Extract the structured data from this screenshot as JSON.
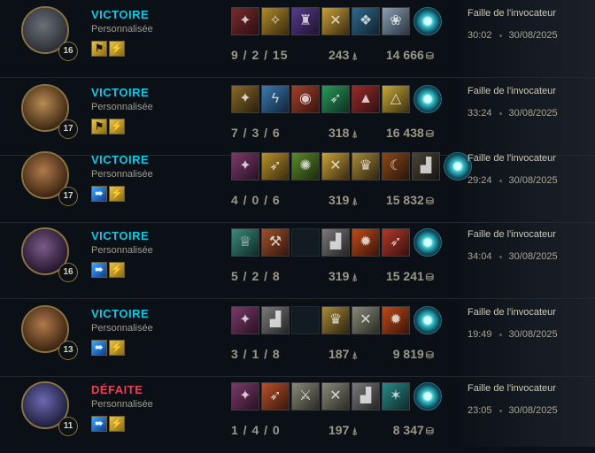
{
  "matches": [
    {
      "result": "VICTOIRE",
      "result_color": "#0acbe6",
      "mode": "Personnalisée",
      "level": "16",
      "champion_icon": "dark-masked-champion-icon",
      "portrait_colors": [
        "#6b6f78",
        "#2a2d33"
      ],
      "spells": [
        {
          "name": "gold-spell-icon",
          "style": "gold",
          "glyph": "⚑"
        },
        {
          "name": "flash-spell-icon",
          "style": "gold",
          "glyph": "⚡"
        }
      ],
      "items": [
        {
          "name": "red-blade-item-icon",
          "c1": "#7a2b2b",
          "c2": "#2a0e12",
          "glyph": "✦"
        },
        {
          "name": "golden-spear-item-icon",
          "c1": "#b08a2a",
          "c2": "#3a2a0c",
          "glyph": "✧"
        },
        {
          "name": "purple-tower-item-icon",
          "c1": "#5a3a8c",
          "c2": "#1c1230",
          "glyph": "♜"
        },
        {
          "name": "crossed-blades-item-icon",
          "c1": "#c9a23a",
          "c2": "#3a2a10",
          "glyph": "✕"
        },
        {
          "name": "blue-eagle-item-icon",
          "c1": "#2f6a8c",
          "c2": "#0e2230",
          "glyph": "❖"
        },
        {
          "name": "white-wings-item-icon",
          "c1": "#8aa0b2",
          "c2": "#2a3440",
          "glyph": "❀"
        }
      ],
      "kda": "9 / 2 / 15",
      "cs": "243",
      "gold": "14 666",
      "map": "Faille de l'invocateur",
      "duration": "30:02",
      "date": "30/08/2025"
    },
    {
      "result": "VICTOIRE",
      "result_color": "#0acbe6",
      "mode": "Personnalisée",
      "level": "17",
      "champion_icon": "skull-helmet-champion-icon",
      "portrait_colors": [
        "#b98a52",
        "#3a2612"
      ],
      "spells": [
        {
          "name": "gold-spell-icon",
          "style": "gold",
          "glyph": "⚑"
        },
        {
          "name": "flash-spell-icon",
          "style": "gold",
          "glyph": "⚡"
        }
      ],
      "items": [
        {
          "name": "gold-crossbow-item-icon",
          "c1": "#8a6a2a",
          "c2": "#2a1e0c",
          "glyph": "✦"
        },
        {
          "name": "blue-lightning-item-icon",
          "c1": "#3a7ab0",
          "c2": "#10243a",
          "glyph": "ϟ"
        },
        {
          "name": "red-cannon-item-icon",
          "c1": "#a0402a",
          "c2": "#3a140c",
          "glyph": "◉"
        },
        {
          "name": "green-dagger-item-icon",
          "c1": "#2a9a5a",
          "c2": "#0c3020",
          "glyph": "➶"
        },
        {
          "name": "red-hat-item-icon",
          "c1": "#9a2a2a",
          "c2": "#301010",
          "glyph": "▲"
        },
        {
          "name": "golden-triangle-item-icon",
          "c1": "#c8a83a",
          "c2": "#3a3010",
          "glyph": "△"
        }
      ],
      "kda": "7 / 3 / 6",
      "cs": "318",
      "gold": "16 438",
      "map": "Faille de l'invocateur",
      "duration": "33:24",
      "date": "30/08/2025"
    },
    {
      "result": "VICTOIRE",
      "result_color": "#0acbe6",
      "mode": "Personnalisée",
      "level": "17",
      "champion_icon": "sun-warrior-champion-icon",
      "portrait_colors": [
        "#b07a4a",
        "#3a2210"
      ],
      "spells": [
        {
          "name": "ghost-spell-icon",
          "style": "blue",
          "glyph": "➠"
        },
        {
          "name": "flash-spell-icon",
          "style": "gold",
          "glyph": "⚡"
        }
      ],
      "items": [
        {
          "name": "purple-dagger-item-icon",
          "c1": "#7a3a6a",
          "c2": "#2a1024",
          "glyph": "✦"
        },
        {
          "name": "golden-arrows-item-icon",
          "c1": "#b8902a",
          "c2": "#3a2c0c",
          "glyph": "➶"
        },
        {
          "name": "green-spikes-item-icon",
          "c1": "#5a8a2a",
          "c2": "#1c2a0c",
          "glyph": "✺"
        },
        {
          "name": "crossed-blades-item-icon",
          "c1": "#c9a23a",
          "c2": "#3a2a10",
          "glyph": "✕"
        },
        {
          "name": "golden-helm-item-icon",
          "c1": "#a88a3a",
          "c2": "#2e2410",
          "glyph": "♛"
        },
        {
          "name": "bow-item-icon",
          "c1": "#8a4a1a",
          "c2": "#2a1408",
          "glyph": "☾"
        },
        {
          "name": "black-boots-item-icon",
          "c1": "#4a4438",
          "c2": "#161410",
          "glyph": "▟"
        }
      ],
      "kda": "4 / 0 / 6",
      "cs": "319",
      "gold": "15 832",
      "map": "Faille de l'invocateur",
      "duration": "29:24",
      "date": "30/08/2025"
    },
    {
      "result": "VICTOIRE",
      "result_color": "#0acbe6",
      "mode": "Personnalisée",
      "level": "16",
      "champion_icon": "purple-hair-champion-icon",
      "portrait_colors": [
        "#7a5a8a",
        "#22142a"
      ],
      "spells": [
        {
          "name": "ghost-spell-icon",
          "style": "blue",
          "glyph": "➠"
        },
        {
          "name": "flash-spell-icon",
          "style": "gold",
          "glyph": "⚡"
        }
      ],
      "items": [
        {
          "name": "teal-crown-item-icon",
          "c1": "#3a8a7a",
          "c2": "#0c2a24",
          "glyph": "♕"
        },
        {
          "name": "red-axe-item-icon",
          "c1": "#a0502a",
          "c2": "#34160c",
          "glyph": "⚒"
        },
        {
          "name": "empty-slot",
          "c1": "",
          "c2": "",
          "glyph": ""
        },
        {
          "name": "steel-boots-item-icon",
          "c1": "#7a7a7a",
          "c2": "#242424",
          "glyph": "▟"
        },
        {
          "name": "fire-blade-item-icon",
          "c1": "#c04a1a",
          "c2": "#3a1408",
          "glyph": "✹"
        },
        {
          "name": "red-arrows-item-icon",
          "c1": "#b03a2a",
          "c2": "#3a100c",
          "glyph": "➶"
        }
      ],
      "kda": "5 / 2 / 8",
      "cs": "319",
      "gold": "15 241",
      "map": "Faille de l'invocateur",
      "duration": "34:04",
      "date": "30/08/2025"
    },
    {
      "result": "VICTOIRE",
      "result_color": "#0acbe6",
      "mode": "Personnalisée",
      "level": "13",
      "champion_icon": "sun-warrior-champion-icon",
      "portrait_colors": [
        "#b07a4a",
        "#3a2210"
      ],
      "spells": [
        {
          "name": "ghost-spell-icon",
          "style": "blue",
          "glyph": "➠"
        },
        {
          "name": "flash-spell-icon",
          "style": "gold",
          "glyph": "⚡"
        }
      ],
      "items": [
        {
          "name": "purple-dagger-item-icon",
          "c1": "#7a3a6a",
          "c2": "#2a1024",
          "glyph": "✦"
        },
        {
          "name": "steel-boots-item-icon",
          "c1": "#7a7a7a",
          "c2": "#242424",
          "glyph": "▟"
        },
        {
          "name": "empty-slot",
          "c1": "",
          "c2": "",
          "glyph": ""
        },
        {
          "name": "golden-helm-item-icon",
          "c1": "#a88a3a",
          "c2": "#2e2410",
          "glyph": "♛"
        },
        {
          "name": "crossed-swords-item-icon",
          "c1": "#8a8a7a",
          "c2": "#2a2a24",
          "glyph": "✕"
        },
        {
          "name": "fire-blade-item-icon",
          "c1": "#c04a1a",
          "c2": "#3a1408",
          "glyph": "✹"
        }
      ],
      "kda": "3 / 1 / 8",
      "cs": "187",
      "gold": "9 819",
      "map": "Faille de l'invocateur",
      "duration": "19:49",
      "date": "30/08/2025"
    },
    {
      "result": "DÉFAITE",
      "result_color": "#e84057",
      "mode": "Personnalisée",
      "level": "11",
      "champion_icon": "glowing-eyes-champion-icon",
      "portrait_colors": [
        "#6a6ab0",
        "#1c1c3a"
      ],
      "spells": [
        {
          "name": "ghost-spell-icon",
          "style": "blue",
          "glyph": "➠"
        },
        {
          "name": "flash-spell-icon",
          "style": "gold",
          "glyph": "⚡"
        }
      ],
      "items": [
        {
          "name": "purple-dagger-item-icon",
          "c1": "#7a3a6a",
          "c2": "#2a1024",
          "glyph": "✦"
        },
        {
          "name": "fire-arrows-item-icon",
          "c1": "#b8502a",
          "c2": "#3a180c",
          "glyph": "➶"
        },
        {
          "name": "steel-sword-item-icon",
          "c1": "#8a8a7a",
          "c2": "#2a2a24",
          "glyph": "⚔"
        },
        {
          "name": "crossed-swords-item-icon",
          "c1": "#8a8a7a",
          "c2": "#2a2a24",
          "glyph": "✕"
        },
        {
          "name": "steel-boots-item-icon",
          "c1": "#7a7a7a",
          "c2": "#242424",
          "glyph": "▟"
        },
        {
          "name": "teal-star-item-icon",
          "c1": "#2a8a8a",
          "c2": "#0c2a2a",
          "glyph": "✶"
        }
      ],
      "kda": "1 / 4 / 0",
      "cs": "197",
      "gold": "8 347",
      "map": "Faille de l'invocateur",
      "duration": "23:05",
      "date": "30/08/2025"
    }
  ],
  "trinket_icon": "ward-trinket-icon",
  "cs_icon": "minion-icon",
  "gold_icon": "gold-coins-icon"
}
